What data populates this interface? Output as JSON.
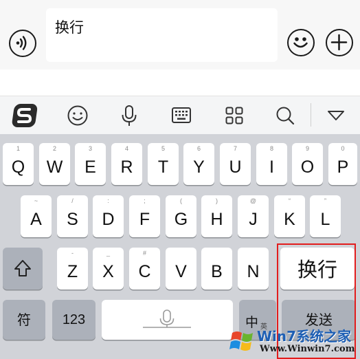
{
  "chat_input": {
    "text": "换行"
  },
  "keyboard": {
    "row1": [
      {
        "sub": "1",
        "label": "Q"
      },
      {
        "sub": "2",
        "label": "W"
      },
      {
        "sub": "3",
        "label": "E"
      },
      {
        "sub": "4",
        "label": "R"
      },
      {
        "sub": "5",
        "label": "T"
      },
      {
        "sub": "6",
        "label": "Y"
      },
      {
        "sub": "7",
        "label": "U"
      },
      {
        "sub": "8",
        "label": "I"
      },
      {
        "sub": "9",
        "label": "O"
      },
      {
        "sub": "0",
        "label": "P"
      }
    ],
    "row2": [
      {
        "sub": "~",
        "label": "A"
      },
      {
        "sub": "/",
        "label": "S"
      },
      {
        "sub": ":",
        "label": "D"
      },
      {
        "sub": ";",
        "label": "F"
      },
      {
        "sub": "(",
        "label": "G"
      },
      {
        "sub": ")",
        "label": "H"
      },
      {
        "sub": "@",
        "label": "J"
      },
      {
        "sub": "“",
        "label": "K"
      },
      {
        "sub": "”",
        "label": "L"
      }
    ],
    "row3": [
      {
        "sub": "-",
        "label": "Z"
      },
      {
        "sub": "_",
        "label": "X"
      },
      {
        "sub": "#",
        "label": "C"
      },
      {
        "sub": "",
        "label": "V"
      },
      {
        "sub": "",
        "label": "B"
      },
      {
        "sub": "",
        "label": "N"
      }
    ],
    "newline_key": "换行",
    "symbol_key": "符",
    "number_key": "123",
    "lang_key_main": "中",
    "lang_key_sub": "英",
    "send_key": "发送"
  },
  "watermark": {
    "title": "Win7系统之家",
    "url": "Www.Winwin7.com"
  },
  "colors": {
    "highlight_border": "#e21c1c",
    "key_background": "#ffffff",
    "function_key_background": "#acb1ba",
    "keyboard_background": "#d1d3d8"
  },
  "icons": [
    "voice-icon",
    "emoji-icon",
    "plus-icon",
    "sogou-logo-icon",
    "smiley-icon",
    "microphone-icon",
    "keyboard-icon",
    "apps-grid-icon",
    "search-icon",
    "collapse-keyboard-icon",
    "shift-icon"
  ]
}
